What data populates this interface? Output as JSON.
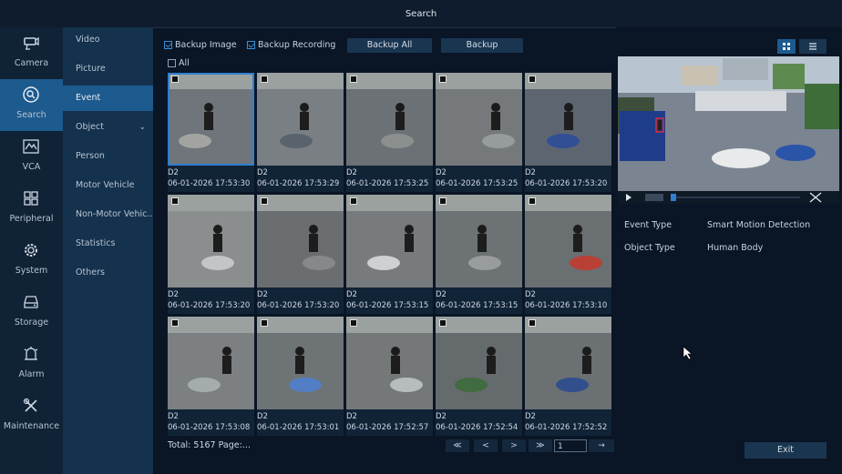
{
  "window": {
    "title": "Search"
  },
  "left_nav": [
    {
      "label": "Camera",
      "icon": "camera-icon"
    },
    {
      "label": "Search",
      "icon": "search-icon",
      "active": true
    },
    {
      "label": "VCA",
      "icon": "vca-icon"
    },
    {
      "label": "Peripheral",
      "icon": "peripheral-icon"
    },
    {
      "label": "System",
      "icon": "gear-icon"
    },
    {
      "label": "Storage",
      "icon": "storage-icon"
    },
    {
      "label": "Alarm",
      "icon": "alarm-icon"
    },
    {
      "label": "Maintenance",
      "icon": "wrench-icon"
    }
  ],
  "sub_nav": [
    {
      "label": "Video"
    },
    {
      "label": "Picture"
    },
    {
      "label": "Event",
      "active": true
    },
    {
      "label": "Object",
      "has_chevron": true
    },
    {
      "label": "Person"
    },
    {
      "label": "Motor Vehicle"
    },
    {
      "label": "Non-Motor Vehic.."
    },
    {
      "label": "Statistics"
    },
    {
      "label": "Others"
    }
  ],
  "toolbar": {
    "backup_image": "Backup Image",
    "backup_recording": "Backup Recording",
    "backup_all": "Backup All",
    "backup": "Backup",
    "all": "All"
  },
  "thumbnails": [
    {
      "channel": "D2",
      "time": "06-01-2026 17:53:30",
      "selected": true
    },
    {
      "channel": "D2",
      "time": "06-01-2026 17:53:29"
    },
    {
      "channel": "D2",
      "time": "06-01-2026 17:53:25"
    },
    {
      "channel": "D2",
      "time": "06-01-2026 17:53:25"
    },
    {
      "channel": "D2",
      "time": "06-01-2026 17:53:20"
    },
    {
      "channel": "D2",
      "time": "06-01-2026 17:53:20"
    },
    {
      "channel": "D2",
      "time": "06-01-2026 17:53:20"
    },
    {
      "channel": "D2",
      "time": "06-01-2026 17:53:15"
    },
    {
      "channel": "D2",
      "time": "06-01-2026 17:53:15"
    },
    {
      "channel": "D2",
      "time": "06-01-2026 17:53:10"
    },
    {
      "channel": "D2",
      "time": "06-01-2026 17:53:08"
    },
    {
      "channel": "D2",
      "time": "06-01-2026 17:53:01"
    },
    {
      "channel": "D2",
      "time": "06-01-2026 17:52:57"
    },
    {
      "channel": "D2",
      "time": "06-01-2026 17:52:54"
    },
    {
      "channel": "D2",
      "time": "06-01-2026 17:52:52"
    }
  ],
  "footer": {
    "total": "Total: 5167  Page:...",
    "first": "≪",
    "prev": "<",
    "next": ">",
    "last": "≫",
    "page_value": "1",
    "go": "→"
  },
  "detail": {
    "event_type_label": "Event Type",
    "event_type_value": "Smart Motion Detection",
    "object_type_label": "Object Type",
    "object_type_value": "Human Body"
  },
  "exit_label": "Exit",
  "colors": {
    "accent": "#1d5a8e",
    "selected": "#2f7fd1",
    "background": "#0a1525"
  }
}
